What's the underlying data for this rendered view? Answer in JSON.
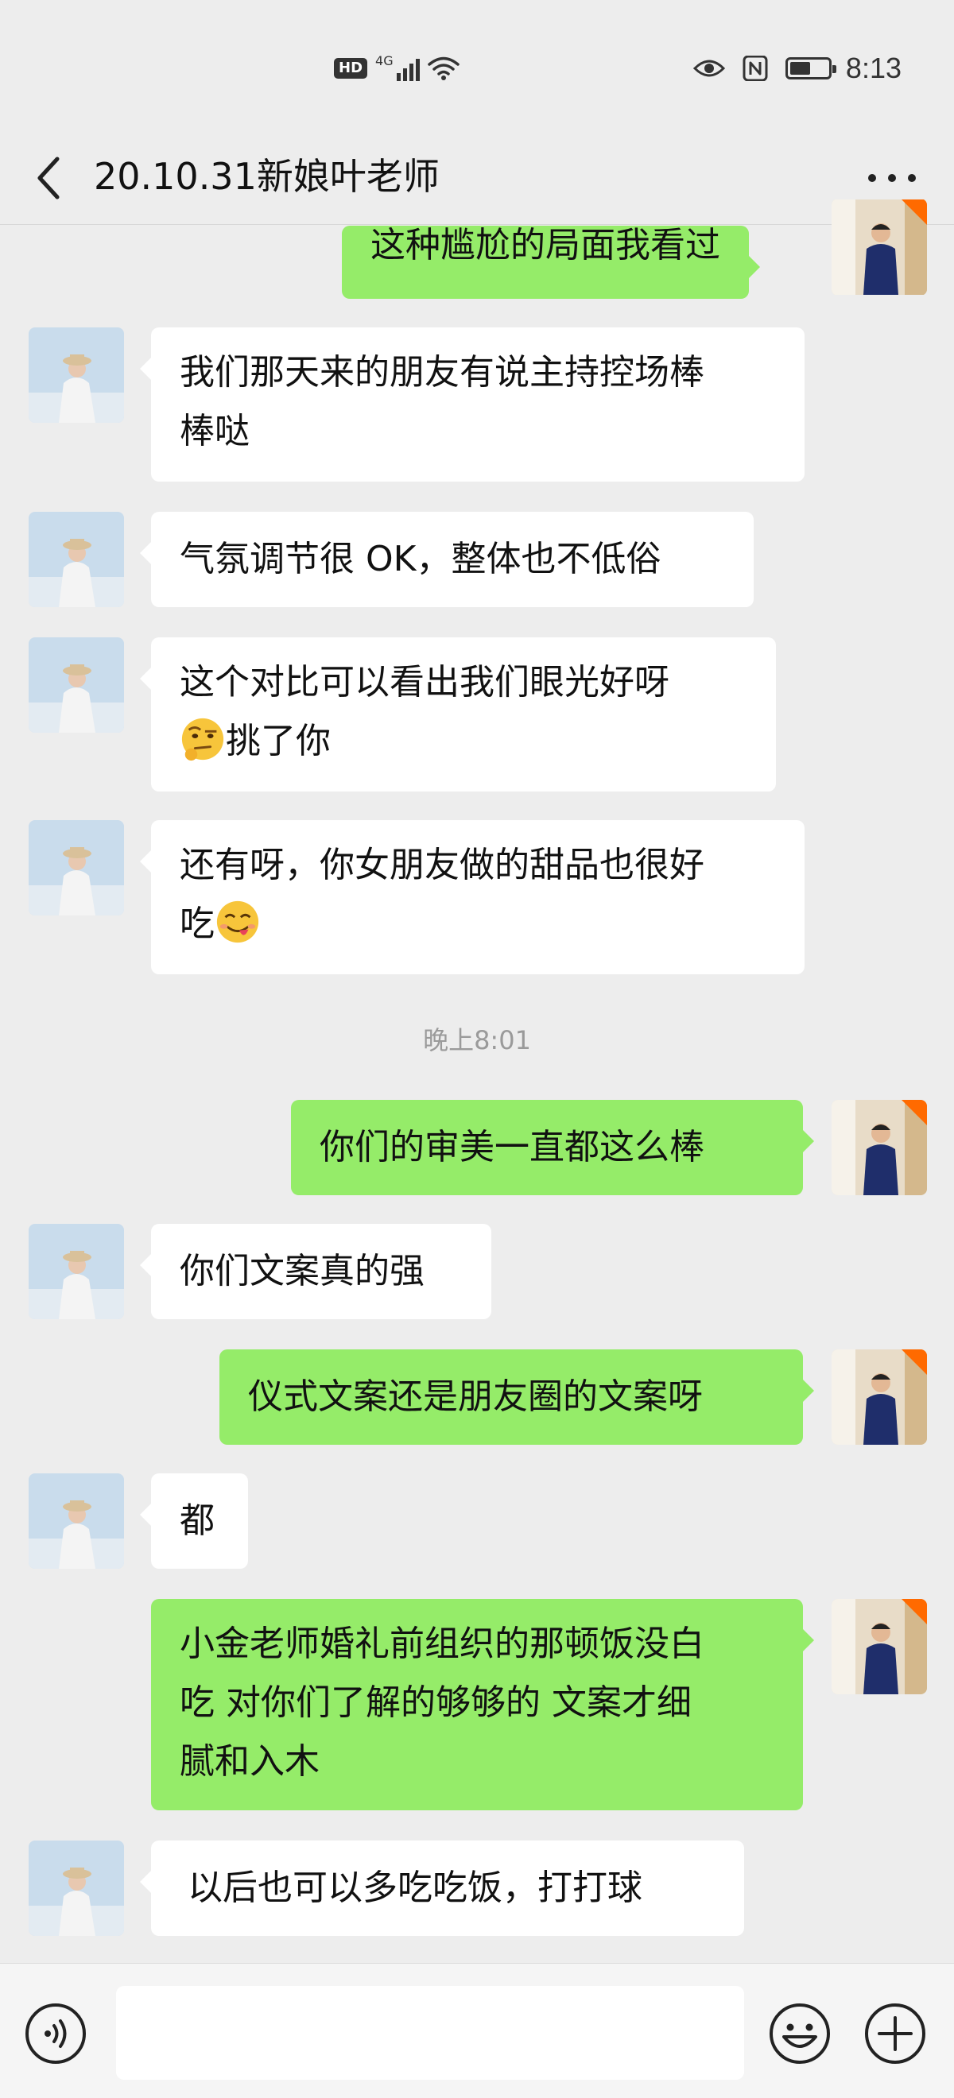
{
  "status_bar": {
    "hd": "HD",
    "network": "4G",
    "time": "8:13",
    "battery_level": 0.55
  },
  "header": {
    "title": "20.10.31新娘叶老师"
  },
  "messages": [
    {
      "side": "out",
      "lines": [
        "这种尴尬的局面我看过"
      ]
    },
    {
      "side": "in",
      "lines": [
        "我们那天来的朋友有说主持控场棒",
        "棒哒"
      ]
    },
    {
      "side": "in",
      "lines": [
        "气氛调节很 OK，整体也不低俗"
      ]
    },
    {
      "side": "in",
      "lines": [
        "这个对比可以看出我们眼光好呀",
        "挑了你"
      ],
      "emoji": "raised-eyebrow-emoji"
    },
    {
      "side": "in",
      "lines": [
        "还有呀，你女朋友做的甜品也很好",
        "吃"
      ],
      "emoji": "yum-face-emoji"
    },
    {
      "side": "out",
      "lines": [
        "你们的审美一直都这么棒"
      ]
    },
    {
      "side": "in",
      "lines": [
        "你们文案真的强"
      ]
    },
    {
      "side": "out",
      "lines": [
        "仪式文案还是朋友圈的文案呀"
      ]
    },
    {
      "side": "in",
      "lines": [
        "都"
      ]
    },
    {
      "side": "out",
      "lines": [
        "小金老师婚礼前组织的那顿饭没白",
        "吃 对你们了解的够够的 文案才细",
        "腻和入木"
      ]
    },
    {
      "side": "in",
      "lines": [
        "以后也可以多吃吃饭，打打球"
      ]
    }
  ],
  "time_separator": "晚上8:01",
  "input_bar": {
    "text": ""
  },
  "colors": {
    "background": "#ededed",
    "outgoing_bubble": "#95ec69",
    "incoming_bubble": "#ffffff"
  }
}
